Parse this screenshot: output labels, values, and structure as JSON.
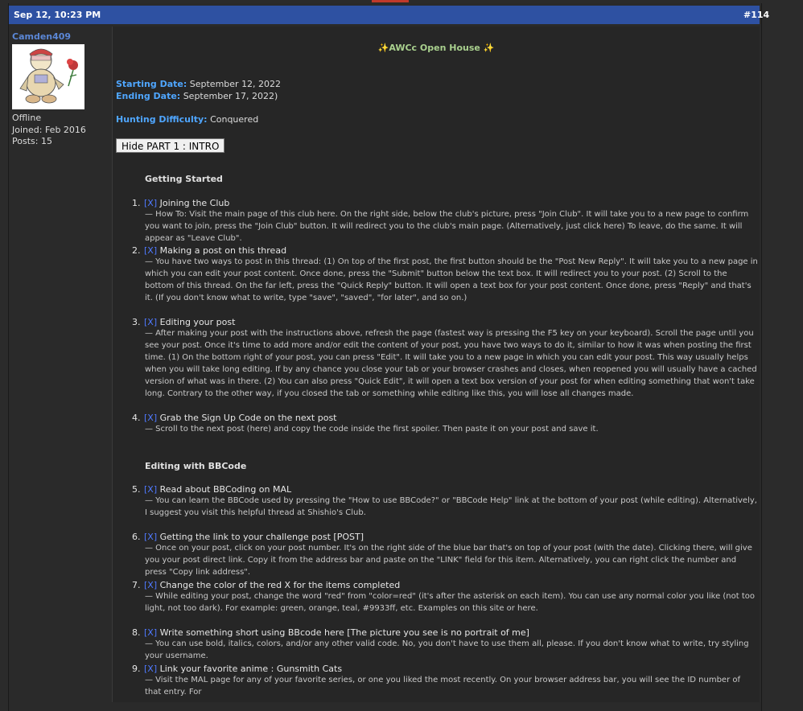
{
  "post": {
    "date": "Sep 12, 10:23 PM",
    "number": "#114"
  },
  "user": {
    "name": "Camden409",
    "status": "Offline",
    "joined": "Joined: Feb 2016",
    "posts": "Posts: 15"
  },
  "content": {
    "title": "✨AWCc Open House ✨",
    "starting_label": "Starting Date:",
    "starting_value": "September 12, 2022",
    "ending_label": "Ending Date:",
    "ending_value": "September 17, 2022)",
    "difficulty_label": "Hunting Difficulty:",
    "difficulty_value": "Conquered",
    "spoiler_button": "Hide PART 1 : INTRO",
    "section1": "Getting Started",
    "section2": "Editing with BBCode",
    "items": [
      {
        "n": "1.",
        "x": "[X]",
        "title": "Joining the Club",
        "desc": "— How To: Visit the main page of this club here. On the right side, below the club's picture, press \"Join Club\". It will take you to a new page to confirm you want to join, press the \"Join Club\" button. It will redirect you to the club's main page. (Alternatively, just click here) To leave, do the same. It will appear as \"Leave Club\"."
      },
      {
        "n": "2.",
        "x": "[X]",
        "title": "Making a post on this thread",
        "desc": "— You have two ways to post in this thread: (1) On top of the first post, the first button should be the \"Post New Reply\". It will take you to a new page in which you can edit your post content. Once done, press the \"Submit\" button below the text box. It will redirect you to your post. (2) Scroll to the bottom of this thread. On the far left, press the \"Quick Reply\" button. It will open a text box for your post content. Once done, press \"Reply\" and that's it. (If you don't know what to write, type \"save\", \"saved\", \"for later\", and so on.)"
      },
      {
        "n": "3.",
        "x": "[X]",
        "title": "Editing your post",
        "desc": "— After making your post with the instructions above, refresh the page (fastest way is pressing the F5 key on your keyboard). Scroll the page until you see your post. Once it's time to add more and/or edit the content of your post, you have two ways to do it, similar to how it was when posting the first time. (1) On the bottom right of your post, you can press \"Edit\". It will take you to a new page in which you can edit your post. This way usually helps when you will take long editing. If by any chance you close your tab or your browser crashes and closes, when reopened you will usually have a cached version of what was in there. (2) You can also press \"Quick Edit\", it will open a text box version of your post for when editing something that won't take long. Contrary to the other way, if you closed the tab or something while editing like this, you will lose all changes made."
      },
      {
        "n": "4.",
        "x": "[X]",
        "title": "Grab the Sign Up Code on the next post",
        "desc": "— Scroll to the next post (here) and copy the code inside the first spoiler. Then paste it on your post and save it."
      },
      {
        "n": "5.",
        "x": "[X]",
        "title": "Read about BBCoding on MAL",
        "desc": "— You can learn the BBCode used by pressing the \"How to use BBCode?\" or \"BBCode Help\" link at the bottom of your post (while editing). Alternatively, I suggest you visit this helpful thread at Shishio's Club."
      },
      {
        "n": "6.",
        "x": "[X]",
        "title": "Getting the link to your challenge post [POST]",
        "desc": "— Once on your post, click on your post number. It's on the right side of the blue bar that's on top of your post (with the date). Clicking there, will give you your post direct link. Copy it from the address bar and paste on the \"LINK\" field for this item. Alternatively, you can right click the number and press \"Copy link address\"."
      },
      {
        "n": "7.",
        "x": "[X]",
        "title": "Change the color of the red X for the items completed",
        "desc": "— While editing your post, change the word \"red\" from \"color=red\" (it's after the asterisk on each item). You can use any normal color you like (not too light, not too dark). For example: green, orange, teal, #9933ff, etc. Examples on this site or here."
      },
      {
        "n": "8.",
        "x": "[X]",
        "title": "Write something short using BBcode here [The picture you see is no portrait of me]",
        "desc": "— You can use bold, italics, colors, and/or any other valid code. No, you don't have to use them all, please. If you don't know what to write, try styling your username."
      },
      {
        "n": "9.",
        "x": "[X]",
        "title": "Link your favorite anime : Gunsmith Cats",
        "desc": "— Visit the MAL page for any of your favorite series, or one you liked the most recently. On your browser address bar, you will see the ID number of that entry. For"
      }
    ]
  },
  "colors": {
    "header_bg": "#2e51a2",
    "accent_blue": "#4fa6ff",
    "title_green": "#a9d08e"
  }
}
